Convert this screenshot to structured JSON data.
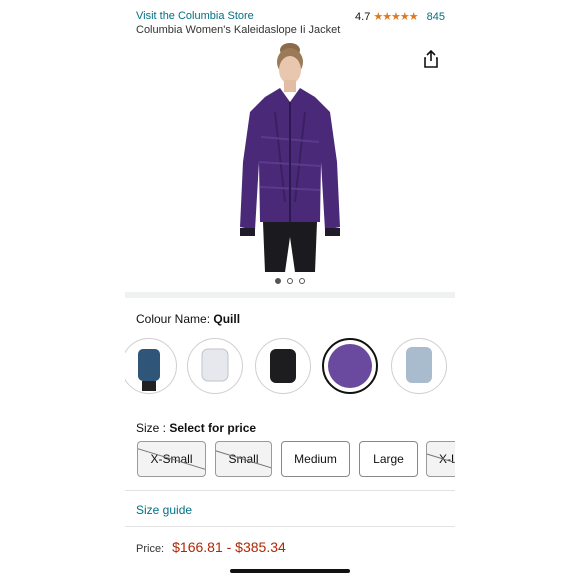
{
  "header": {
    "store_link": "Visit the Columbia Store",
    "rating": "4.7",
    "stars": "★★★★★",
    "review_count": "845",
    "product_title": "Columbia Women's Kaleidaslope Ii Jacket"
  },
  "gallery": {
    "page_count": 3,
    "current_page": 1
  },
  "colour": {
    "label": "Colour Name:",
    "value": "Quill"
  },
  "size": {
    "label": "Size :",
    "value": "Select for price",
    "options": [
      "X-Small",
      "Small",
      "Medium",
      "Large",
      "X-L"
    ]
  },
  "size_guide": "Size guide",
  "price": {
    "label": "Price:",
    "range": "$166.81 - $385.34"
  },
  "colors": {
    "accent_link": "#007185",
    "price": "#b12704",
    "stars": "#de7921",
    "selected_swatch": "#6a4a9e"
  }
}
